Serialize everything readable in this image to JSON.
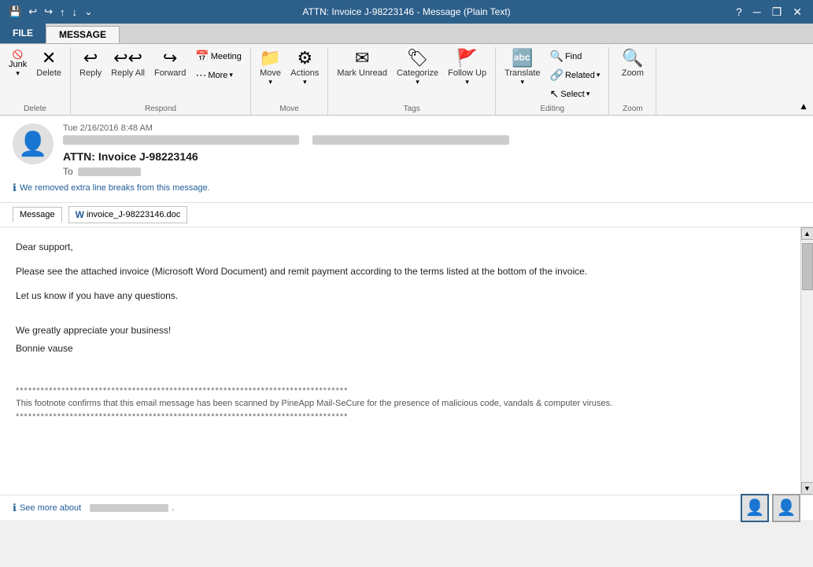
{
  "titlebar": {
    "title": "ATTN: Invoice J-98223146 - Message (Plain Text)",
    "help_btn": "?",
    "minimize_btn": "─",
    "restore_btn": "❒",
    "close_btn": "✕"
  },
  "tabs": {
    "file_label": "FILE",
    "message_label": "MESSAGE"
  },
  "ribbon": {
    "delete_group": {
      "label": "Delete",
      "junk_label": "Junk",
      "delete_label": "Delete"
    },
    "respond_group": {
      "label": "Respond",
      "reply_label": "Reply",
      "reply_all_label": "Reply All",
      "forward_label": "Forward",
      "meeting_label": "Meeting",
      "more_label": "More"
    },
    "move_group": {
      "label": "Move",
      "move_label": "Move",
      "actions_label": "Actions"
    },
    "tags_group": {
      "label": "Tags",
      "mark_unread_label": "Mark Unread",
      "categorize_label": "Categorize",
      "follow_up_label": "Follow Up"
    },
    "editing_group": {
      "label": "Editing",
      "translate_label": "Translate",
      "find_label": "Find",
      "related_label": "Related",
      "select_label": "Select"
    },
    "zoom_group": {
      "label": "Zoom",
      "zoom_label": "Zoom"
    }
  },
  "email": {
    "date": "Tue 2/16/2016 8:48 AM",
    "subject": "ATTN: Invoice J-98223146",
    "to_label": "To",
    "info_message": "We removed extra line breaks from this message.",
    "tab_message": "Message",
    "attachment_name": "invoice_J-98223146.doc",
    "body_line1": "Dear support,",
    "body_line2": "Please see the attached invoice (Microsoft Word Document) and remit payment according to the terms listed at the bottom of the invoice.",
    "body_line3": "Let us know if you have any questions.",
    "body_line4": "We greatly appreciate your business!",
    "body_line5": "Bonnie vause",
    "footnote_stars": "********************************************************************************",
    "footnote_stars2": "********************************************************************************",
    "footnote_text": "This footnote confirms that this email message has been scanned by PineApp Mail-SeCure for the presence of malicious code, vandals & computer viruses.",
    "footer_see_more": "See more about"
  }
}
